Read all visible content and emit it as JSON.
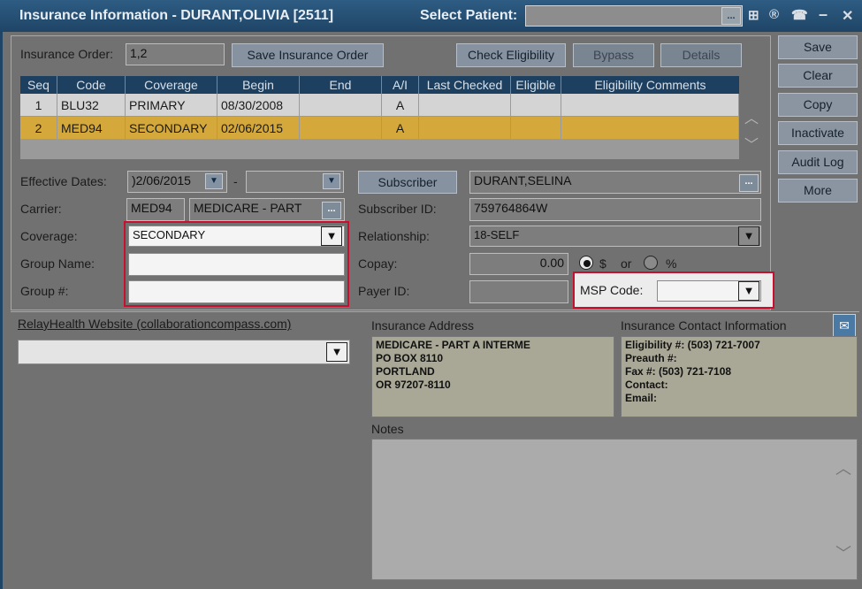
{
  "window": {
    "title": "Insurance Information - DURANT,OLIVIA [2511]",
    "select_patient_label": "Select Patient:",
    "select_patient_value": "",
    "toolbar_buttons": [
      "...",
      "⊞",
      "®",
      "☎"
    ],
    "minimize": "–",
    "close": "✕"
  },
  "top": {
    "insurance_order_label": "Insurance Order:",
    "insurance_order_value": "1,2",
    "save_order_button": "Save Insurance Order",
    "check_eligibility_button": "Check Eligibility",
    "bypass_button": "Bypass",
    "details_button": "Details"
  },
  "grid": {
    "columns": [
      "Seq",
      "Code",
      "Coverage",
      "Begin",
      "End",
      "A/I",
      "Last Checked",
      "Eligible",
      "Eligibility Comments"
    ],
    "rows": [
      {
        "seq": "1",
        "code": "BLU32",
        "coverage": "PRIMARY",
        "begin": "08/30/2008",
        "end": "",
        "ai": "A",
        "last_checked": "",
        "eligible": "",
        "comments": ""
      },
      {
        "seq": "2",
        "code": "MED94",
        "coverage": "SECONDARY",
        "begin": "02/06/2015",
        "end": "",
        "ai": "A",
        "last_checked": "",
        "eligible": "",
        "comments": ""
      }
    ]
  },
  "form": {
    "effective_dates_label": "Effective Dates:",
    "effective_from": ")2/06/2015",
    "effective_to": "",
    "dash": "-",
    "carrier_label": "Carrier:",
    "carrier_code": "MED94",
    "carrier_name": "MEDICARE - PART",
    "coverage_label": "Coverage:",
    "coverage_value": "SECONDARY",
    "group_name_label": "Group Name:",
    "group_name_value": "",
    "group_number_label": "Group #:",
    "group_number_value": "",
    "subscriber_button": "Subscriber",
    "subscriber_value": "DURANT,SELINA",
    "subscriber_id_label": "Subscriber ID:",
    "subscriber_id_value": "759764864W",
    "relationship_label": "Relationship:",
    "relationship_value": "18-SELF",
    "copay_label": "Copay:",
    "copay_value": "0.00",
    "copay_dollar": "$",
    "copay_or": "or",
    "copay_percent": "%",
    "payer_id_label": "Payer ID:",
    "payer_id_value": "",
    "msp_code_label": "MSP Code:",
    "msp_code_value": ""
  },
  "side": {
    "save": "Save",
    "clear": "Clear",
    "copy": "Copy",
    "inactivate": "Inactivate",
    "audit_log": "Audit Log",
    "more": "More"
  },
  "bottom": {
    "website_link": "RelayHealth Website (collaborationcompass.com)",
    "website_select_value": "",
    "insurance_address_label": "Insurance Address",
    "insurance_address_text": "MEDICARE - PART A INTERME\nPO BOX 8110\nPORTLAND\nOR 97207-8110",
    "contact_label": "Insurance Contact Information",
    "contact_text": "Eligibility #: (503) 721-7007\nPreauth #:\nFax #: (503) 721-7108\nContact:\nEmail:",
    "notes_label": "Notes",
    "notes_value": ""
  },
  "colors": {
    "title_bar": "#1f4566",
    "grid_header": "#1e4060",
    "selected_row": "#d4a83a",
    "highlight_border": "#c8102e"
  }
}
